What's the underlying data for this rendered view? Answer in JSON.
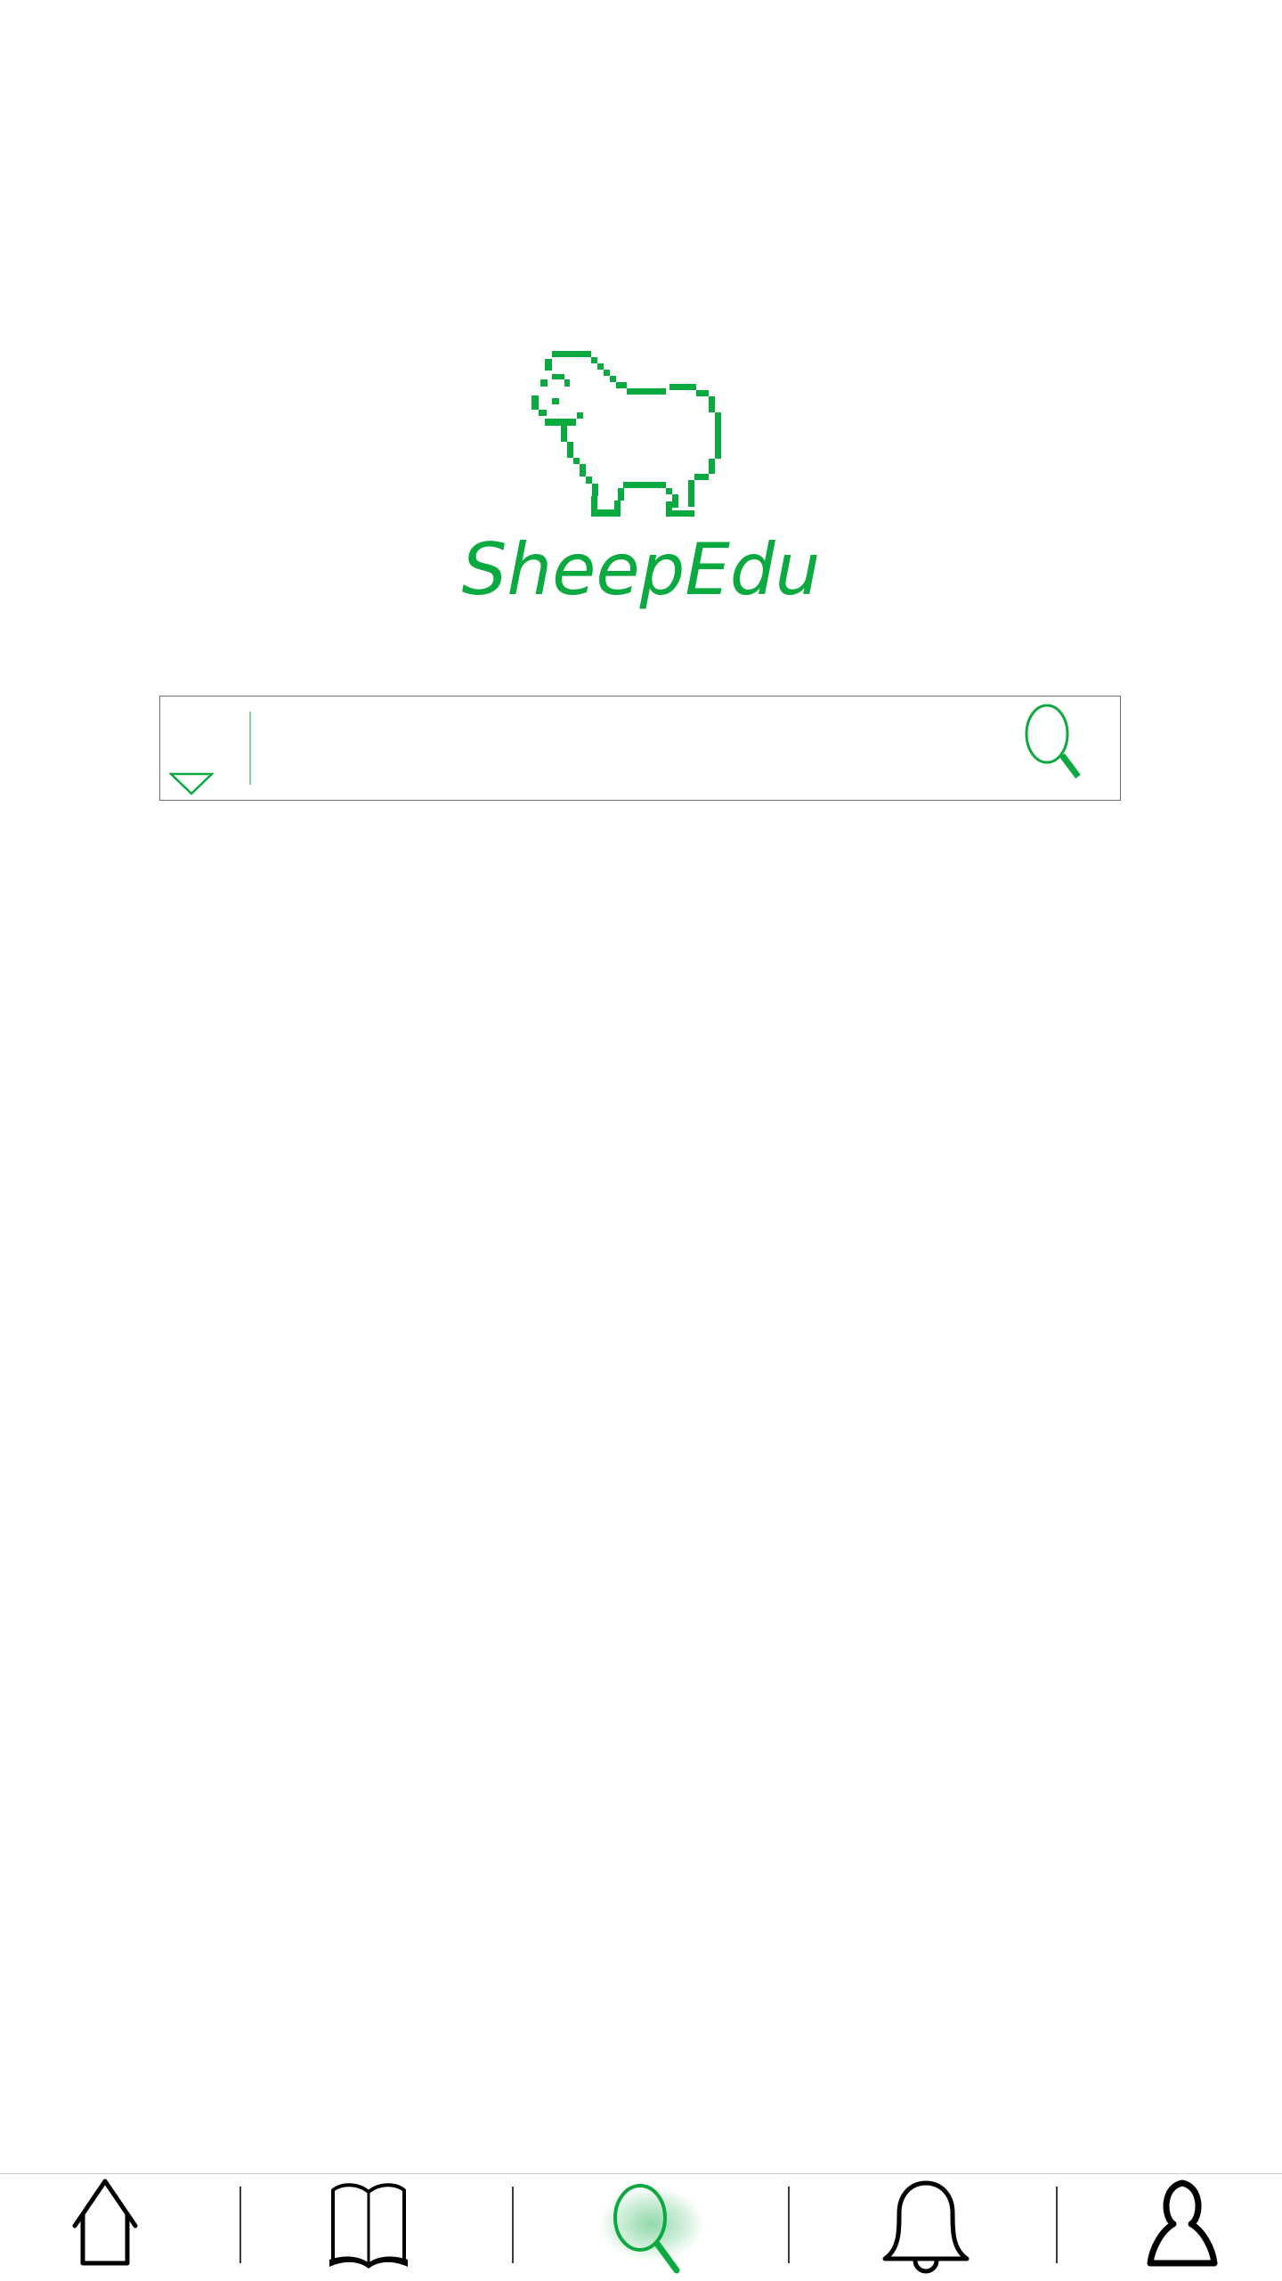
{
  "app": {
    "name": "SheepEdu",
    "accent_color": "#0aaa40",
    "logo_icon": "sheep-icon"
  },
  "search": {
    "placeholder": "",
    "value": "",
    "category_icon": "triangle-down-icon",
    "submit_icon": "search-icon"
  },
  "bottom_nav": {
    "active_tab": "search",
    "items": [
      {
        "id": "home",
        "icon": "home-icon"
      },
      {
        "id": "library",
        "icon": "book-icon"
      },
      {
        "id": "search",
        "icon": "search-icon"
      },
      {
        "id": "notifications",
        "icon": "bell-icon"
      },
      {
        "id": "profile",
        "icon": "user-icon"
      }
    ]
  }
}
